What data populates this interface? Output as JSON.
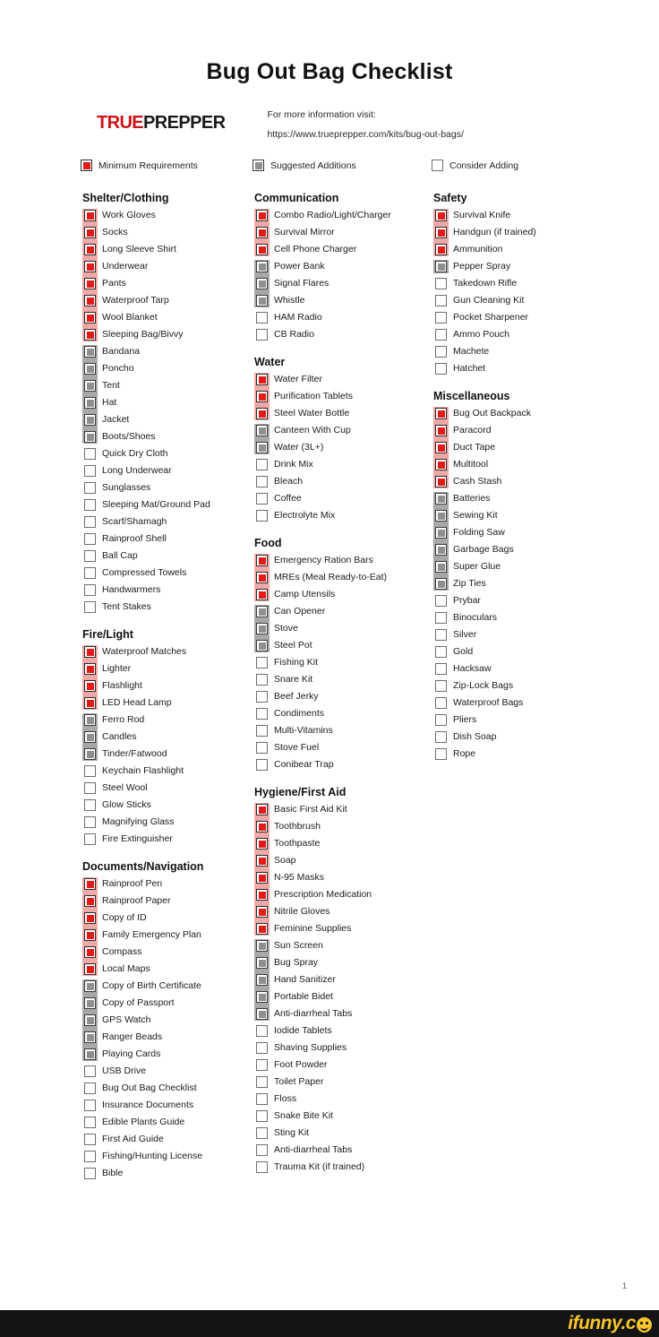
{
  "document": {
    "title": "Bug Out Bag Checklist",
    "page_number": "1"
  },
  "brand": {
    "name_part1": "TRUE",
    "name_part2": "PREPPER",
    "info_label": "For more information visit:",
    "info_url": "https://www.trueprepper.com/kits/bug-out-bags/",
    "accent_color": "#cc1418"
  },
  "legend": {
    "items": [
      {
        "state": "min",
        "label": "Minimum Requirements"
      },
      {
        "state": "sug",
        "label": "Suggested Additions"
      },
      {
        "state": "con",
        "label": "Consider Adding"
      }
    ]
  },
  "colors": {
    "minimum": "#e31b18",
    "suggested": "#8f8f8f",
    "consider": "#ffffff",
    "min_group_bar": "#f0a9a6",
    "sug_group_bar": "#a8a8a8",
    "watermark_yellow": "#f7c52b"
  },
  "watermark": {
    "text": "ifunny.c",
    "icon": "smiley-face-icon"
  },
  "columns": [
    {
      "id": "column-1",
      "sections": [
        {
          "title": "Shelter/Clothing",
          "items": [
            {
              "label": "Work Gloves",
              "state": "min"
            },
            {
              "label": "Socks",
              "state": "min"
            },
            {
              "label": "Long Sleeve Shirt",
              "state": "min"
            },
            {
              "label": "Underwear",
              "state": "min"
            },
            {
              "label": "Pants",
              "state": "min"
            },
            {
              "label": "Waterproof Tarp",
              "state": "min"
            },
            {
              "label": "Wool Blanket",
              "state": "min"
            },
            {
              "label": "Sleeping Bag/Bivvy",
              "state": "min"
            },
            {
              "label": "Bandana",
              "state": "sug"
            },
            {
              "label": "Poncho",
              "state": "sug"
            },
            {
              "label": "Tent",
              "state": "sug"
            },
            {
              "label": "Hat",
              "state": "sug"
            },
            {
              "label": "Jacket",
              "state": "sug"
            },
            {
              "label": "Boots/Shoes",
              "state": "sug"
            },
            {
              "label": "Quick Dry Cloth",
              "state": "con"
            },
            {
              "label": "Long Underwear",
              "state": "con"
            },
            {
              "label": "Sunglasses",
              "state": "con"
            },
            {
              "label": "Sleeping Mat/Ground Pad",
              "state": "con"
            },
            {
              "label": "Scarf/Shamagh",
              "state": "con"
            },
            {
              "label": "Rainproof Shell",
              "state": "con"
            },
            {
              "label": "Ball Cap",
              "state": "con"
            },
            {
              "label": "Compressed Towels",
              "state": "con"
            },
            {
              "label": "Handwarmers",
              "state": "con"
            },
            {
              "label": "Tent Stakes",
              "state": "con"
            }
          ]
        },
        {
          "title": "Fire/Light",
          "items": [
            {
              "label": "Waterproof Matches",
              "state": "min"
            },
            {
              "label": "Lighter",
              "state": "min"
            },
            {
              "label": "Flashlight",
              "state": "min"
            },
            {
              "label": "LED Head Lamp",
              "state": "min"
            },
            {
              "label": "Ferro Rod",
              "state": "sug"
            },
            {
              "label": "Candles",
              "state": "sug"
            },
            {
              "label": "Tinder/Fatwood",
              "state": "sug"
            },
            {
              "label": "Keychain Flashlight",
              "state": "con"
            },
            {
              "label": "Steel Wool",
              "state": "con"
            },
            {
              "label": "Glow Sticks",
              "state": "con"
            },
            {
              "label": "Magnifying Glass",
              "state": "con"
            },
            {
              "label": "Fire Extinguisher",
              "state": "con"
            }
          ]
        },
        {
          "title": "Documents/Navigation",
          "items": [
            {
              "label": "Rainproof Pen",
              "state": "min"
            },
            {
              "label": "Rainproof Paper",
              "state": "min"
            },
            {
              "label": "Copy of ID",
              "state": "min"
            },
            {
              "label": "Family Emergency Plan",
              "state": "min"
            },
            {
              "label": "Compass",
              "state": "min"
            },
            {
              "label": "Local Maps",
              "state": "min"
            },
            {
              "label": "Copy of Birth Certificate",
              "state": "sug"
            },
            {
              "label": "Copy of Passport",
              "state": "sug"
            },
            {
              "label": "GPS Watch",
              "state": "sug"
            },
            {
              "label": "Ranger Beads",
              "state": "sug"
            },
            {
              "label": "Playing Cards",
              "state": "sug"
            },
            {
              "label": "USB Drive",
              "state": "con"
            },
            {
              "label": "Bug Out Bag Checklist",
              "state": "con"
            },
            {
              "label": "Insurance Documents",
              "state": "con"
            },
            {
              "label": "Edible Plants Guide",
              "state": "con"
            },
            {
              "label": "First Aid Guide",
              "state": "con"
            },
            {
              "label": "Fishing/Hunting License",
              "state": "con"
            },
            {
              "label": "Bible",
              "state": "con"
            }
          ]
        }
      ]
    },
    {
      "id": "column-2",
      "sections": [
        {
          "title": "Communication",
          "items": [
            {
              "label": "Combo Radio/Light/Charger",
              "state": "min"
            },
            {
              "label": "Survival Mirror",
              "state": "min"
            },
            {
              "label": "Cell Phone Charger",
              "state": "min"
            },
            {
              "label": "Power Bank",
              "state": "sug"
            },
            {
              "label": "Signal Flares",
              "state": "sug"
            },
            {
              "label": "Whistle",
              "state": "sug"
            },
            {
              "label": "HAM Radio",
              "state": "con"
            },
            {
              "label": "CB Radio",
              "state": "con"
            }
          ]
        },
        {
          "title": "Water",
          "items": [
            {
              "label": "Water Filter",
              "state": "min"
            },
            {
              "label": "Purification Tablets",
              "state": "min"
            },
            {
              "label": "Steel Water Bottle",
              "state": "min"
            },
            {
              "label": "Canteen With Cup",
              "state": "sug"
            },
            {
              "label": "Water (3L+)",
              "state": "sug"
            },
            {
              "label": "Drink Mix",
              "state": "con"
            },
            {
              "label": "Bleach",
              "state": "con"
            },
            {
              "label": "Coffee",
              "state": "con"
            },
            {
              "label": "Electrolyte Mix",
              "state": "con"
            }
          ]
        },
        {
          "title": "Food",
          "items": [
            {
              "label": "Emergency Ration Bars",
              "state": "min"
            },
            {
              "label": "MREs (Meal Ready-to-Eat)",
              "state": "min"
            },
            {
              "label": "Camp Utensils",
              "state": "min"
            },
            {
              "label": "Can Opener",
              "state": "sug"
            },
            {
              "label": "Stove",
              "state": "sug"
            },
            {
              "label": "Steel Pot",
              "state": "sug"
            },
            {
              "label": "Fishing Kit",
              "state": "con"
            },
            {
              "label": "Snare Kit",
              "state": "con"
            },
            {
              "label": "Beef Jerky",
              "state": "con"
            },
            {
              "label": "Condiments",
              "state": "con"
            },
            {
              "label": "Multi-Vitamins",
              "state": "con"
            },
            {
              "label": "Stove Fuel",
              "state": "con"
            },
            {
              "label": "Conibear Trap",
              "state": "con"
            }
          ]
        },
        {
          "title": "Hygiene/First Aid",
          "items": [
            {
              "label": "Basic First Aid Kit",
              "state": "min"
            },
            {
              "label": "Toothbrush",
              "state": "min"
            },
            {
              "label": "Toothpaste",
              "state": "min"
            },
            {
              "label": "Soap",
              "state": "min"
            },
            {
              "label": "N-95 Masks",
              "state": "min"
            },
            {
              "label": "Prescription Medication",
              "state": "min"
            },
            {
              "label": "Nitrile Gloves",
              "state": "min"
            },
            {
              "label": "Feminine Supplies",
              "state": "min"
            },
            {
              "label": "Sun Screen",
              "state": "sug"
            },
            {
              "label": "Bug Spray",
              "state": "sug"
            },
            {
              "label": "Hand Sanitizer",
              "state": "sug"
            },
            {
              "label": "Portable Bidet",
              "state": "sug"
            },
            {
              "label": "Anti-diarrheal Tabs",
              "state": "sug"
            },
            {
              "label": "Iodide Tablets",
              "state": "con"
            },
            {
              "label": "Shaving Supplies",
              "state": "con"
            },
            {
              "label": "Foot Powder",
              "state": "con"
            },
            {
              "label": "Toilet Paper",
              "state": "con"
            },
            {
              "label": "Floss",
              "state": "con"
            },
            {
              "label": "Snake Bite Kit",
              "state": "con"
            },
            {
              "label": "Sting Kit",
              "state": "con"
            },
            {
              "label": "Anti-diarrheal Tabs",
              "state": "con"
            },
            {
              "label": "Trauma Kit (if trained)",
              "state": "con"
            }
          ]
        }
      ]
    },
    {
      "id": "column-3",
      "sections": [
        {
          "title": "Safety",
          "items": [
            {
              "label": "Survival Knife",
              "state": "min"
            },
            {
              "label": "Handgun (if trained)",
              "state": "min"
            },
            {
              "label": "Ammunition",
              "state": "min"
            },
            {
              "label": "Pepper Spray",
              "state": "sug"
            },
            {
              "label": "Takedown Rifle",
              "state": "con"
            },
            {
              "label": "Gun Cleaning Kit",
              "state": "con"
            },
            {
              "label": "Pocket Sharpener",
              "state": "con"
            },
            {
              "label": "Ammo Pouch",
              "state": "con"
            },
            {
              "label": "Machete",
              "state": "con"
            },
            {
              "label": "Hatchet",
              "state": "con"
            }
          ]
        },
        {
          "title": "Miscellaneous",
          "items": [
            {
              "label": "Bug Out Backpack",
              "state": "min"
            },
            {
              "label": "Paracord",
              "state": "min"
            },
            {
              "label": "Duct Tape",
              "state": "min"
            },
            {
              "label": "Multitool",
              "state": "min"
            },
            {
              "label": "Cash Stash",
              "state": "min"
            },
            {
              "label": "Batteries",
              "state": "sug"
            },
            {
              "label": "Sewing Kit",
              "state": "sug"
            },
            {
              "label": "Folding Saw",
              "state": "sug"
            },
            {
              "label": "Garbage Bags",
              "state": "sug"
            },
            {
              "label": "Super Glue",
              "state": "sug"
            },
            {
              "label": "Zip Ties",
              "state": "sug"
            },
            {
              "label": "Prybar",
              "state": "con"
            },
            {
              "label": "Binoculars",
              "state": "con"
            },
            {
              "label": "Silver",
              "state": "con"
            },
            {
              "label": "Gold",
              "state": "con"
            },
            {
              "label": "Hacksaw",
              "state": "con"
            },
            {
              "label": "Zip-Lock Bags",
              "state": "con"
            },
            {
              "label": "Waterproof Bags",
              "state": "con"
            },
            {
              "label": "Pliers",
              "state": "con"
            },
            {
              "label": "Dish Soap",
              "state": "con"
            },
            {
              "label": "Rope",
              "state": "con"
            }
          ]
        }
      ]
    }
  ]
}
